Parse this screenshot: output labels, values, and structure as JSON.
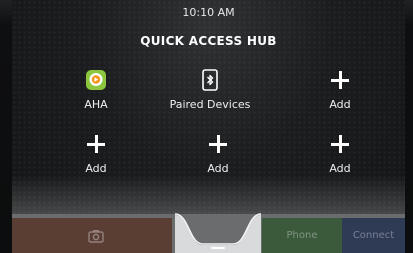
{
  "status_bar": {
    "time": "10:10 AM"
  },
  "hub": {
    "title": "QUICK ACCESS HUB",
    "tiles": [
      {
        "label": "AHA",
        "icon": "aha-app-icon"
      },
      {
        "label": "Paired Devices",
        "icon": "bluetooth-phone-icon"
      },
      {
        "label": "Add",
        "icon": "plus-icon"
      },
      {
        "label": "Add",
        "icon": "plus-icon"
      },
      {
        "label": "Add",
        "icon": "plus-icon"
      },
      {
        "label": "Add",
        "icon": "plus-icon"
      }
    ]
  },
  "dock": {
    "phone_label": "Phone",
    "connect_label": "Connect",
    "colors": {
      "nav": "#5a3e34",
      "phone": "#3b5a3c",
      "connect": "#2f3a55"
    }
  },
  "colors": {
    "aha_green": "#8dc63f",
    "aha_orange": "#f7941d"
  }
}
